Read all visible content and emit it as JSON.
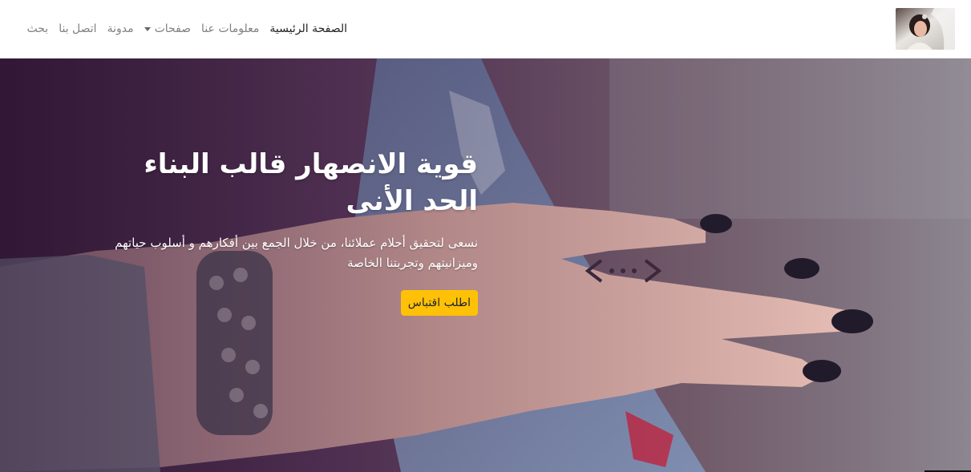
{
  "nav": {
    "logo_icon": "bride-portrait-logo",
    "items": [
      {
        "label": "الصفحة الرئيسية",
        "active": true
      },
      {
        "label": "معلومات عنا",
        "active": false
      },
      {
        "label": "صفحات",
        "active": false,
        "dropdown": true
      },
      {
        "label": "مدونة",
        "active": false
      },
      {
        "label": "اتصل بنا",
        "active": false
      },
      {
        "label": "بحث",
        "active": false
      }
    ]
  },
  "hero": {
    "title": "قوية الانصهار قالب البناء الحد الأنى",
    "subtitle": "نسعى لتحقيق أحلام عملائنا، من خلال الجمع بين أفكارهم و أسلوب حياتهم وميزانيتهم وتجربتنا الخاصة",
    "cta_label": "اطلب اقتباس",
    "background": "hand-with-tattoo-and-bracelet-photo",
    "colors": {
      "cta": "#ffc107",
      "overlay": "#3a1f3f"
    }
  }
}
